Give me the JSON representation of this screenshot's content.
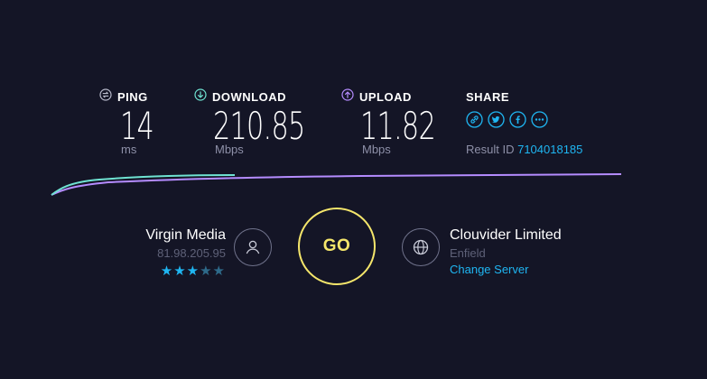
{
  "colors": {
    "background": "#141526",
    "accent_blue": "#1fb6f2",
    "go_yellow": "#f5e66b",
    "download_green": "#6fe3d2",
    "upload_purple": "#b58cff",
    "muted_text": "#8e90a8"
  },
  "metrics": {
    "ping": {
      "label": "PING",
      "value": "14",
      "unit": "ms",
      "icon": "ping-icon"
    },
    "download": {
      "label": "DOWNLOAD",
      "value": "210.85",
      "unit": "Mbps",
      "icon": "download-arrow-icon"
    },
    "upload": {
      "label": "UPLOAD",
      "value": "11.82",
      "unit": "Mbps",
      "icon": "upload-arrow-icon"
    }
  },
  "share": {
    "label": "SHARE",
    "icons": [
      "link-icon",
      "twitter-icon",
      "facebook-icon",
      "more-icon"
    ],
    "result_label": "Result ID",
    "result_id": "7104018185"
  },
  "isp": {
    "name": "Virgin Media",
    "ip": "81.98.205.95",
    "rating": 3,
    "rating_max": 5
  },
  "go_label": "GO",
  "server": {
    "name": "Clouvider Limited",
    "location": "Enfield",
    "change_label": "Change Server"
  }
}
